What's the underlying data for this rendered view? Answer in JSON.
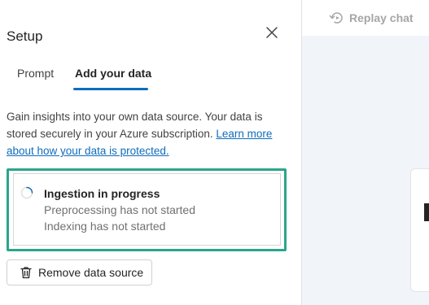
{
  "panel": {
    "title": "Setup",
    "tabs": [
      {
        "label": "Prompt",
        "selected": false
      },
      {
        "label": "Add your data",
        "selected": true
      }
    ],
    "description": "Gain insights into your own data source. Your data is stored securely in your Azure subscription.",
    "learn_more_link": "Learn more about how your data is protected.",
    "ingestion": {
      "title": "Ingestion in progress",
      "preprocessing_status": "Preprocessing has not started",
      "indexing_status": "Indexing has not started"
    },
    "remove_button_label": "Remove data source"
  },
  "chat": {
    "replay_label": "Replay chat"
  },
  "colors": {
    "accent": "#0f6cbd",
    "highlight_border": "#2aa58a",
    "chat_background": "#f1f4f9"
  },
  "icons": [
    "close-icon",
    "spinner-icon",
    "trash-icon",
    "replay-icon"
  ]
}
